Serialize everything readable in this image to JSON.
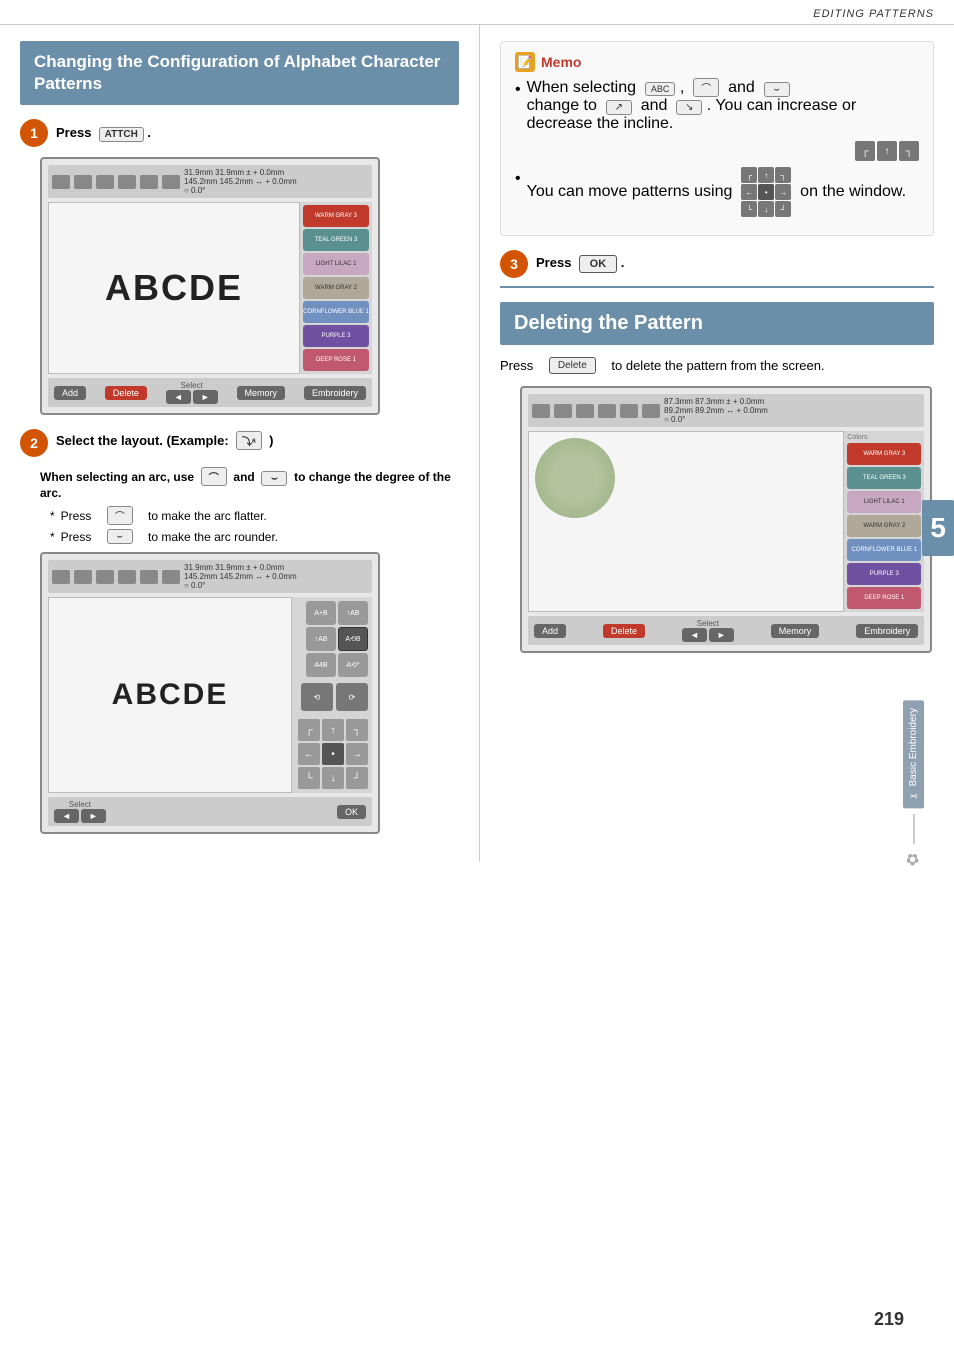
{
  "header": {
    "title": "EDITING PATTERNS"
  },
  "left_section": {
    "heading": "Changing the Configuration of Alphabet Character Patterns",
    "step1": {
      "number": "1",
      "text": "Press",
      "button_label": "ATTCH",
      "period": "."
    },
    "screen1": {
      "stats_line1": "31.9mm   31.9mm ± +   0.0mm",
      "stats_line2": "145.2mm  145.2mm ↔ +  0.0mm",
      "stats_line3": "○  0.0°",
      "text_display": "ABCDE",
      "panel_buttons": [
        "WARM GRAY",
        "TEAL GREEN",
        "LIGHT LILAC",
        "WARM GRAY",
        "CORNFLOWER",
        "PURPLE",
        "DEEP ROSE"
      ],
      "bottom_add": "Add",
      "bottom_delete": "Delete",
      "bottom_prev": "◄",
      "bottom_next": "►",
      "bottom_memory": "Memory",
      "bottom_embroidery": "Embroidery",
      "select_label": "Select"
    },
    "step2": {
      "number": "2",
      "text": "Select the layout. (Example:",
      "example_icon": "layout-icon",
      "sub_note": "When selecting an arc, use",
      "and_text": "and",
      "to_text": "to change the degree of the arc.",
      "bullet1_press": "Press",
      "bullet1_text": "to make the arc flatter.",
      "bullet2_press": "Press",
      "bullet2_text": "to make the arc rounder."
    },
    "screen2": {
      "stats_line1": "31.9mm   31.9mm ± +   0.0mm",
      "stats_line2": "145.2mm  145.2mm ↔ +  0.0mm",
      "stats_line3": "○  0.0°",
      "text_display": "ABCDE",
      "layout_rows": [
        [
          "A+B",
          "↑A B",
          "A B↑"
        ],
        [
          "↑A B",
          "A⟲B",
          "A⟳B"
        ],
        [
          "A4B",
          "A⟲ᵒ"
        ]
      ],
      "arc_buttons": [
        "⟲",
        "⟳"
      ],
      "dir_grid": [
        "↖",
        "↑",
        "↗",
        "←",
        "•",
        "→",
        "↙",
        "↓",
        "↘"
      ],
      "bottom_prev": "◄",
      "bottom_next": "►",
      "bottom_ok": "OK",
      "select_label": "Select"
    }
  },
  "right_section": {
    "memo": {
      "title": "Memo",
      "items": [
        {
          "bullet": "•",
          "text_before": "When selecting",
          "icons": [
            "ABC-icon",
            "arc1-icon",
            "arc2-icon"
          ],
          "and_text": "and",
          "text_after": "change to",
          "icons2": [
            "arrow1-icon",
            "arrow2-icon"
          ],
          "text_after2": "and",
          "text_after3": ". You can increase or decrease the incline."
        },
        {
          "bullet": "•",
          "text": "You can move patterns using",
          "icon": "arrows-icon",
          "text2": "on the window."
        }
      ]
    },
    "step3": {
      "number": "3",
      "text": "Press",
      "ok_label": "OK",
      "period": "."
    },
    "deleting_section": {
      "heading": "Deleting the Pattern",
      "description_before": "Press",
      "delete_key": "Delete",
      "description_after": "to delete the pattern from the screen.",
      "screen": {
        "stats_line1": "87.3mm  87.3mm ± +  0.0mm",
        "stats_line2": "89.2mm  89.2mm ↔ +  0.0mm",
        "stats_line3": "○  0.0°",
        "color_items": [
          {
            "label": "WARM GRAY",
            "count": "3",
            "color": "#b0a898"
          },
          {
            "label": "TEAL GREEN",
            "count": "3",
            "color": "#5a9090"
          },
          {
            "label": "LIGHT LILAC",
            "count": "1",
            "color": "#c8a8c0"
          },
          {
            "label": "WARM GRAY",
            "count": "2",
            "color": "#b0a898"
          },
          {
            "label": "CORNFLOWER BLUE",
            "count": "1",
            "color": "#7090c0"
          },
          {
            "label": "PURPLE",
            "count": "3",
            "color": "#7050a0"
          },
          {
            "label": "DEEP ROSE",
            "count": "1",
            "color": "#c05870"
          }
        ],
        "bottom_add": "Add",
        "bottom_delete": "Delete",
        "bottom_prev": "◄",
        "bottom_next": "►",
        "bottom_memory": "Memory",
        "bottom_embroidery": "Embroidery",
        "select_label": "Select"
      }
    }
  },
  "sidebar": {
    "tab_label": "Basic Embroidery"
  },
  "page_number": "219",
  "chapter_number": "5"
}
